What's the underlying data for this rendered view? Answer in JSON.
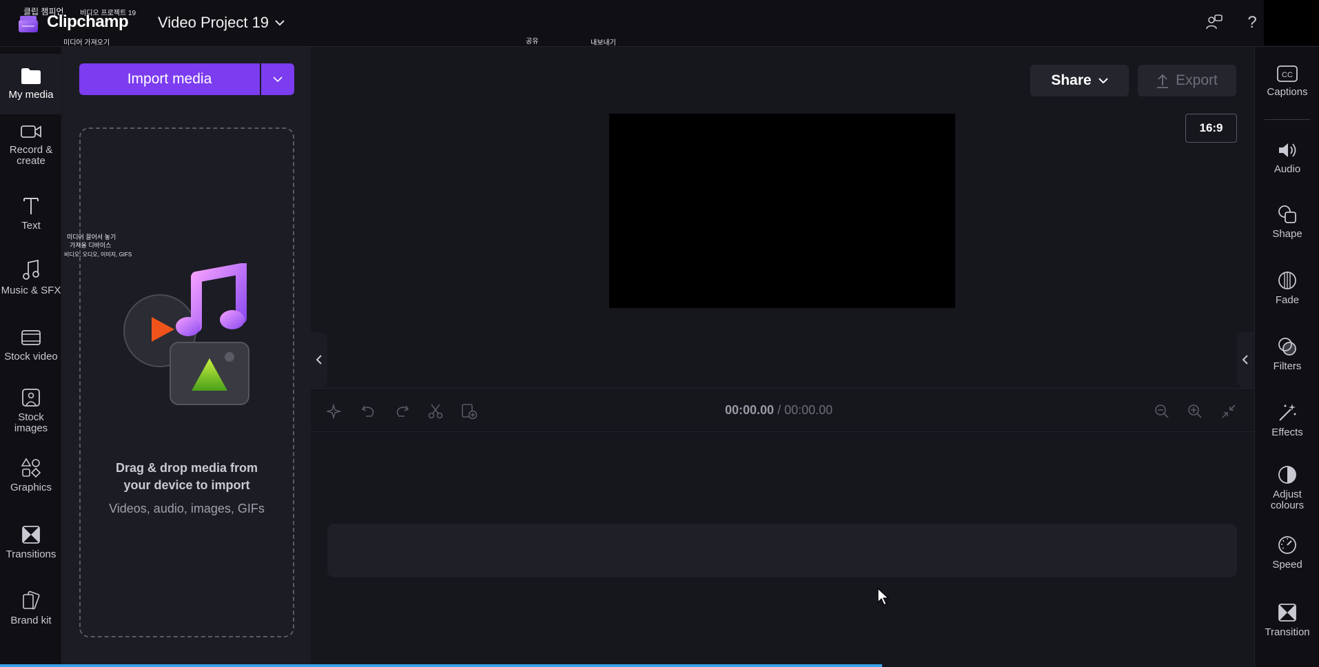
{
  "header": {
    "brand": "Clipchamp",
    "brand_ko": "클립 챔피언",
    "project_ko": "비디오 프로젝트 19",
    "import_ko": "미디어 가져오기",
    "share_ko": "공유",
    "export_ko": "내보내기",
    "project_title": "Video Project 19"
  },
  "left_rail": {
    "items": [
      {
        "label": "My media",
        "icon": "folder-icon"
      },
      {
        "label": "Record & create",
        "icon": "camera-icon"
      },
      {
        "label": "Text",
        "icon": "text-icon"
      },
      {
        "label": "Music & SFX",
        "icon": "music-icon"
      },
      {
        "label": "Stock video",
        "icon": "film-icon"
      },
      {
        "label": "Stock images",
        "icon": "image-icon"
      },
      {
        "label": "Graphics",
        "icon": "shapes-icon"
      },
      {
        "label": "Transitions",
        "icon": "transition-icon"
      },
      {
        "label": "Brand kit",
        "icon": "brand-kit-icon"
      }
    ]
  },
  "media_panel": {
    "import_label": "Import media",
    "drop_title_line1": "Drag & drop media from",
    "drop_title_line2": "your device to import",
    "drop_sub": "Videos, audio, images, GIFs",
    "ko_drop1": "미디어 끌어서 놓기",
    "ko_drop2": "가져올 디바이스",
    "ko_drop3": "비디오, 오디오, 이미지, GIFS"
  },
  "preview": {
    "share_label": "Share",
    "export_label": "Export",
    "aspect_ratio": "16:9"
  },
  "timeline": {
    "current_time": "00:00.00",
    "separator": " / ",
    "total_time": "00:00.00"
  },
  "right_rail": {
    "items": [
      {
        "label": "Captions",
        "icon": "captions-icon"
      },
      {
        "label": "Audio",
        "icon": "speaker-icon"
      },
      {
        "label": "Shape",
        "icon": "shape-icon"
      },
      {
        "label": "Fade",
        "icon": "fade-icon"
      },
      {
        "label": "Filters",
        "icon": "filters-icon"
      },
      {
        "label": "Effects",
        "icon": "effects-icon"
      },
      {
        "label": "Adjust colours",
        "icon": "adjust-icon"
      },
      {
        "label": "Speed",
        "icon": "speed-icon"
      },
      {
        "label": "Transition",
        "icon": "transition-icon"
      }
    ]
  },
  "colors": {
    "accent": "#7c3cf0",
    "background": "#16161d",
    "panel": "#1c1c24",
    "rail": "#0f0f14"
  }
}
